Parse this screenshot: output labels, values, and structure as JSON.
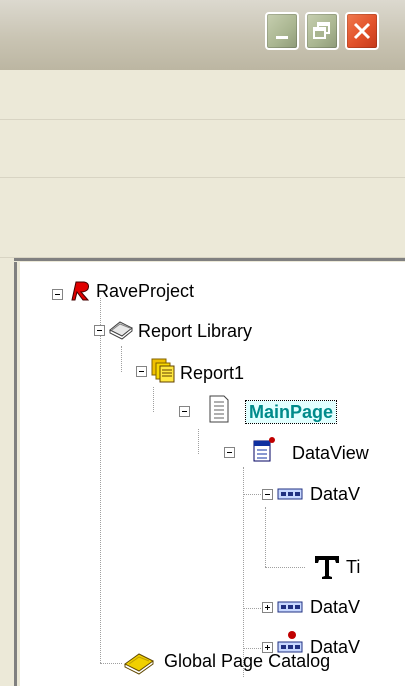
{
  "window": {
    "buttons": {
      "minimize": "minimize-icon",
      "restore": "restore-icon",
      "close": "close-icon"
    }
  },
  "colors": {
    "close_button": "#e2512a",
    "tree_background": "#ffffff",
    "selected_text": "#008b8b",
    "selected_bg": "#e0ffff"
  },
  "tree": {
    "root": "RaveProject",
    "report_library": "Report Library",
    "report1": "Report1",
    "mainpage": "MainPage",
    "dataview_outer": "DataView",
    "dataview_inner1": "DataV",
    "text_item": "Ti",
    "dataview_inner2": "DataV",
    "dataview_inner3": "DataV",
    "global_catalog": "Global Page Catalog"
  }
}
